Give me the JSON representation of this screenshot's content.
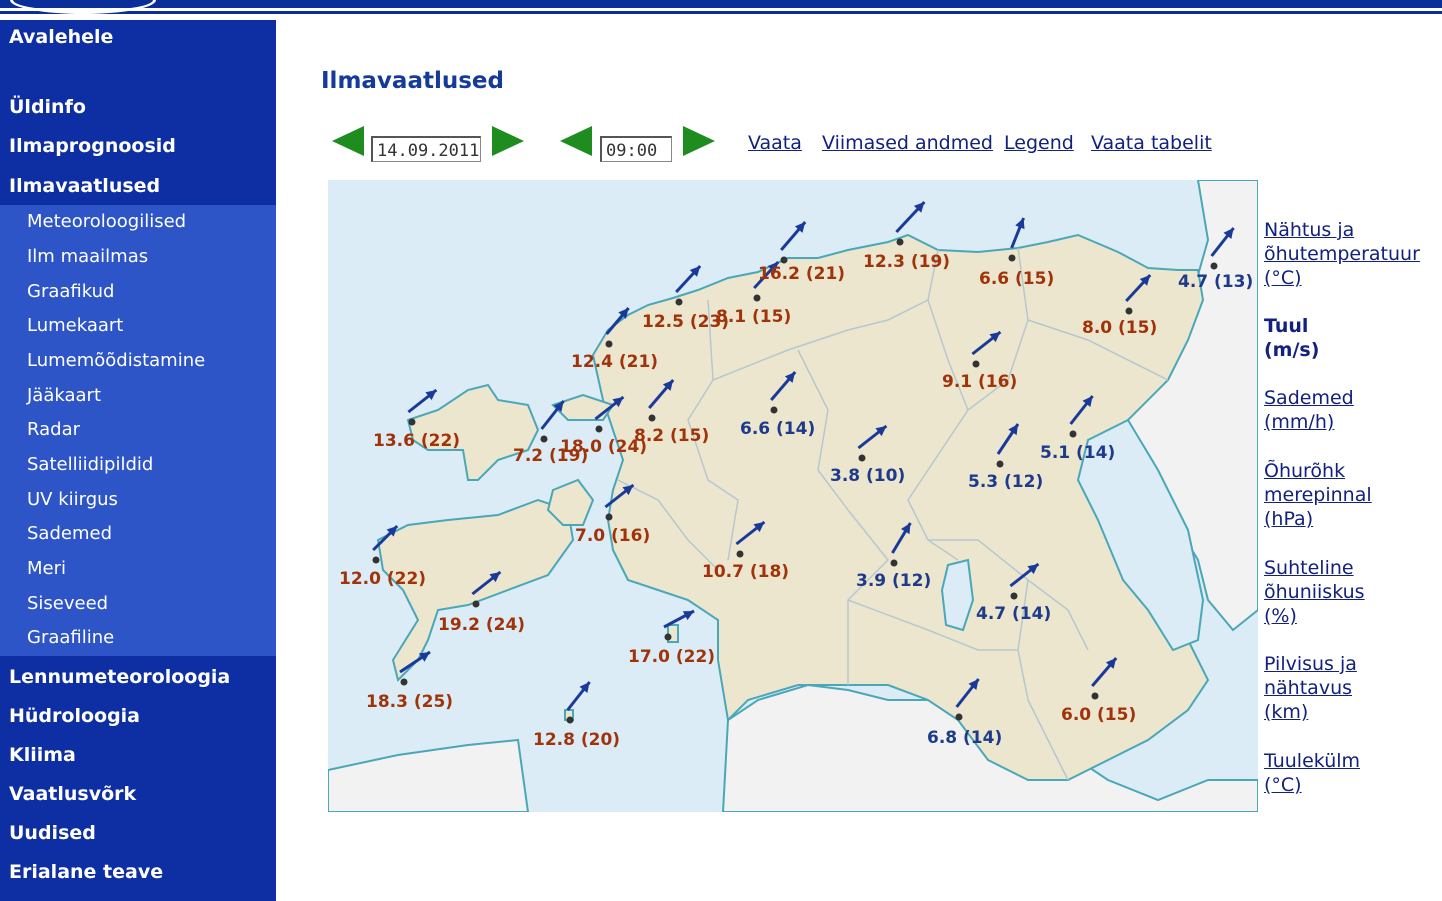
{
  "nav": {
    "home": "Avalehele",
    "items_top": [
      "Üldinfo",
      "Ilmaprognoosid",
      "Ilmavaatlused"
    ],
    "sub_items": [
      "Meteoroloogilised",
      "Ilm maailmas",
      "Graafikud",
      "Lumekaart",
      "Lumemõõdistamine",
      "Jääkaart",
      "Radar",
      "Satelliidipildid",
      "UV kiirgus",
      "Sademed",
      "Meri",
      "Siseveed",
      "Graafiline"
    ],
    "items_bottom": [
      "Lennumeteoroloogia",
      "Hüdroloogia",
      "Kliima",
      "Vaatlusvõrk",
      "Uudised",
      "Erialane teave"
    ]
  },
  "page": {
    "title": "Ilmavaatlused",
    "date_value": "14.09.2011",
    "time_value": "09:00",
    "links": [
      "Vaata",
      "Viimased andmed",
      "Legend",
      "Vaata tabelit"
    ]
  },
  "map": {
    "observations": [
      {
        "label": "12.3 (19)",
        "color": "#a0330a"
      },
      {
        "label": "16.2 (21)",
        "color": "#a0330a"
      },
      {
        "label": "6.6 (15)",
        "color": "#a0330a"
      },
      {
        "label": "4.7 (13)",
        "color": "#1d3b8a"
      },
      {
        "label": "12.5 (23)",
        "color": "#a0330a"
      },
      {
        "label": "8.1 (15)",
        "color": "#a0330a"
      },
      {
        "label": "8.0 (15)",
        "color": "#a0330a"
      },
      {
        "label": "12.4 (21)",
        "color": "#a0330a"
      },
      {
        "label": "9.1 (16)",
        "color": "#a0330a"
      },
      {
        "label": "13.6 (22)",
        "color": "#a0330a"
      },
      {
        "label": "6.6 (14)",
        "color": "#1d3b8a"
      },
      {
        "label": "8.2 (15)",
        "color": "#a0330a"
      },
      {
        "label": "18.0 (24)",
        "color": "#a0330a"
      },
      {
        "label": "7.2 (19)",
        "color": "#a0330a"
      },
      {
        "label": "5.1 (14)",
        "color": "#1d3b8a"
      },
      {
        "label": "3.8 (10)",
        "color": "#1d3b8a"
      },
      {
        "label": "5.3 (12)",
        "color": "#1d3b8a"
      },
      {
        "label": "7.0 (16)",
        "color": "#a0330a"
      },
      {
        "label": "12.0 (22)",
        "color": "#a0330a"
      },
      {
        "label": "10.7 (18)",
        "color": "#a0330a"
      },
      {
        "label": "3.9 (12)",
        "color": "#1d3b8a"
      },
      {
        "label": "19.2 (24)",
        "color": "#a0330a"
      },
      {
        "label": "4.7 (14)",
        "color": "#1d3b8a"
      },
      {
        "label": "17.0 (22)",
        "color": "#a0330a"
      },
      {
        "label": "18.3 (25)",
        "color": "#a0330a"
      },
      {
        "label": "6.0 (15)",
        "color": "#a0330a"
      },
      {
        "label": "6.8 (14)",
        "color": "#1d3b8a"
      },
      {
        "label": "12.8 (20)",
        "color": "#a0330a"
      }
    ]
  },
  "legend_side": {
    "temp": [
      "Nähtus ja",
      "õhutemperatuur",
      "(°C)"
    ],
    "wind": [
      "Tuul",
      "(m/s)"
    ],
    "precip": [
      "Sademed",
      "(mm/h)"
    ],
    "pressure": [
      "Õhurõhk",
      "merepinnal",
      "(hPa)"
    ],
    "humidity": [
      "Suhteline",
      "õhuniiskus",
      "(%)"
    ],
    "cloud": [
      "Pilvisus ja",
      "nähtavus",
      "(km)"
    ],
    "windchill": [
      "Tuulekülm",
      "(°C)"
    ]
  }
}
